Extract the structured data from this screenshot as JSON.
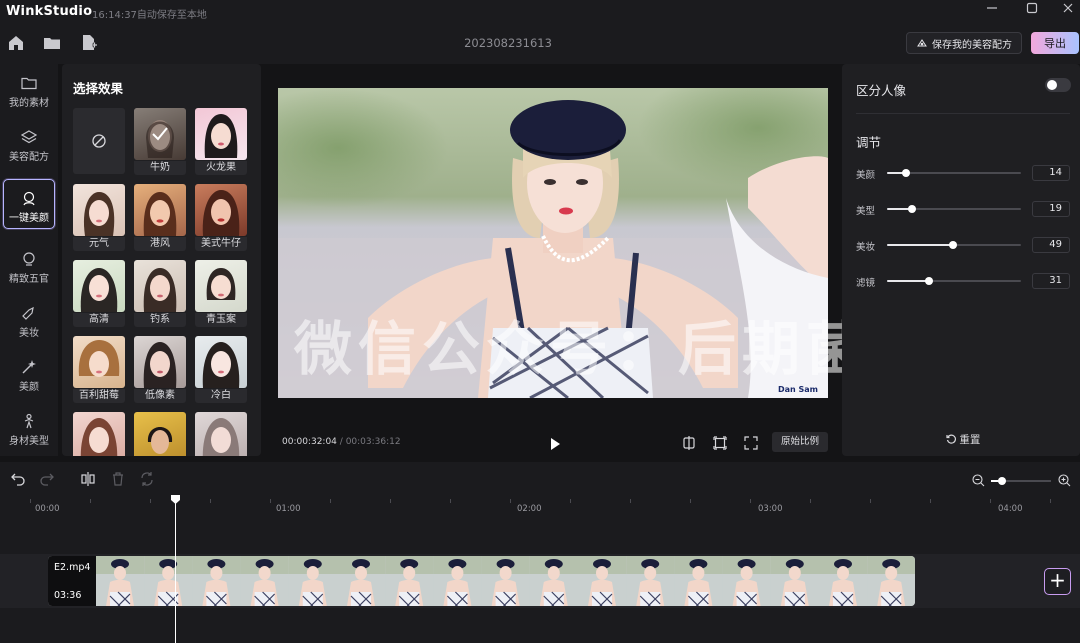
{
  "app": {
    "name": "WinkStudio",
    "autosave": "16:14:37自动保存至本地",
    "project": "202308231613"
  },
  "header": {
    "save_recipe": "保存我的美容配方",
    "export": "导出"
  },
  "nav": [
    {
      "label": "我的素材",
      "icon": "folder-icon"
    },
    {
      "label": "美容配方",
      "icon": "layers-icon"
    },
    {
      "label": "一键美颜",
      "icon": "face-magic-icon",
      "active": true
    },
    {
      "label": "精致五官",
      "icon": "face-outline-icon"
    },
    {
      "label": "美妆",
      "icon": "lipstick-icon"
    },
    {
      "label": "美颜",
      "icon": "wand-icon"
    },
    {
      "label": "身材美型",
      "icon": "body-icon"
    }
  ],
  "effects": {
    "title": "选择效果",
    "tiles": [
      {
        "label": "",
        "kind": "none"
      },
      {
        "label": "牛奶",
        "selected": true
      },
      {
        "label": "火龙果"
      },
      {
        "label": "元气"
      },
      {
        "label": "港风"
      },
      {
        "label": "美式牛仔"
      },
      {
        "label": "高清"
      },
      {
        "label": "钓系"
      },
      {
        "label": "青玉案"
      },
      {
        "label": "百利甜莓"
      },
      {
        "label": "低像素"
      },
      {
        "label": "冷白"
      },
      {
        "label": ""
      },
      {
        "label": ""
      },
      {
        "label": ""
      }
    ]
  },
  "preview": {
    "watermark": "微信公众号：后期菌",
    "current_time": "00:00:32:04",
    "total_time": "00:03:36:12",
    "ratio_button": "原始比例"
  },
  "right_panel": {
    "separate_portrait": "区分人像",
    "separate_portrait_on": false,
    "adjust_title": "调节",
    "sliders": [
      {
        "label": "美颜",
        "value": 14,
        "max": 100
      },
      {
        "label": "美型",
        "value": 19,
        "max": 100
      },
      {
        "label": "美妆",
        "value": 49,
        "max": 100
      },
      {
        "label": "滤镜",
        "value": 31,
        "max": 100
      }
    ],
    "reset": "重置"
  },
  "timeline": {
    "ruler": [
      "00:00",
      "01:00",
      "02:00",
      "03:00",
      "04:00"
    ],
    "clip_name": "E2.mp4",
    "clip_duration": "03:36",
    "add_button": "+"
  },
  "colors": {
    "accent": "#b7b5ff",
    "export_start": "#f2a8dc",
    "export_end": "#a9c3ff"
  }
}
